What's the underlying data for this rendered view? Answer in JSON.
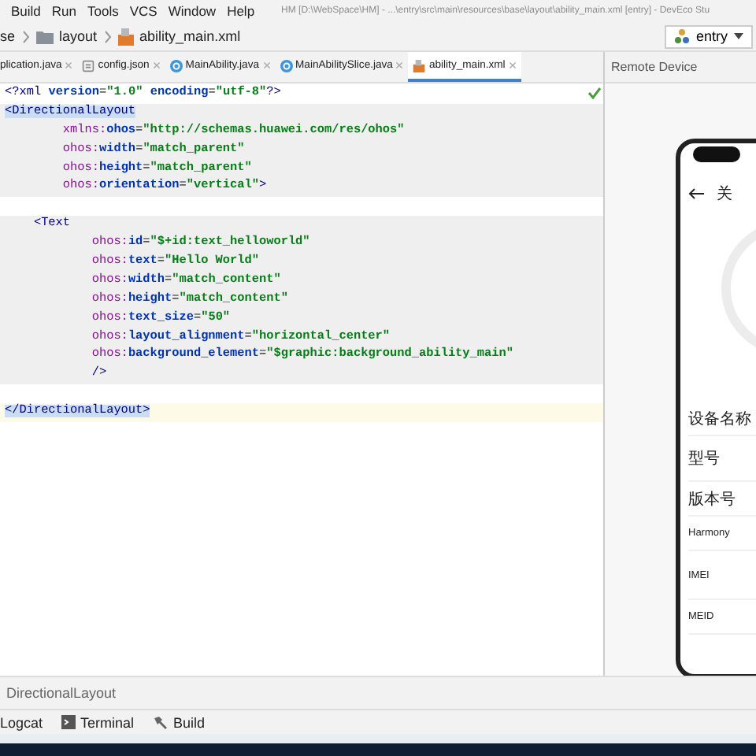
{
  "menu_bar": {
    "items": [
      "Build",
      "Run",
      "Tools",
      "VCS",
      "Window",
      "Help"
    ],
    "title": "HM [D:\\WebSpace\\HM] - ...\\entry\\src\\main\\resources\\base\\layout\\ability_main.xml [entry] - DevEco Stu"
  },
  "breadcrumb": [
    {
      "label": "se",
      "kind": "text"
    },
    {
      "label": "layout",
      "kind": "folder"
    },
    {
      "label": "ability_main.xml",
      "kind": "file"
    }
  ],
  "run_config": {
    "label": "entry"
  },
  "tabs": [
    {
      "label": "plication.java",
      "kind": "plain",
      "selected": false
    },
    {
      "label": "config.json",
      "kind": "json",
      "selected": false
    },
    {
      "label": "MainAbility.java",
      "kind": "class",
      "selected": false
    },
    {
      "label": "MainAbilitySlice.java",
      "kind": "class",
      "selected": false
    },
    {
      "label": "ability_main.xml",
      "kind": "xml",
      "selected": true
    }
  ],
  "editor": {
    "lines": [
      {
        "text": "<?xml version=\"1.0\" encoding=\"utf-8\"?>",
        "shaded": false,
        "current": false,
        "matched": false
      },
      {
        "text": "<DirectionalLayout",
        "shaded": true,
        "current": false,
        "matched": true
      },
      {
        "text": "        xmlns:ohos=\"http://schemas.huawei.com/res/ohos\"",
        "shaded": true,
        "current": false,
        "matched": false
      },
      {
        "text": "        ohos:width=\"match_parent\"",
        "shaded": true,
        "current": false,
        "matched": false
      },
      {
        "text": "        ohos:height=\"match_parent\"",
        "shaded": true,
        "current": false,
        "matched": false
      },
      {
        "text": "        ohos:orientation=\"vertical\">",
        "shaded": true,
        "current": false,
        "matched": false
      },
      {
        "shaded": false,
        "current": false,
        "matched": false
      },
      {
        "text": "    <Text",
        "shaded": true,
        "current": false,
        "matched": false
      },
      {
        "text": "            ohos:id=\"$+id:text_helloworld\"",
        "shaded": true,
        "current": false,
        "matched": false
      },
      {
        "text": "            ohos:text=\"Hello World\"",
        "shaded": true,
        "current": false,
        "matched": false
      },
      {
        "text": "            ohos:width=\"match_content\"",
        "shaded": true,
        "current": false,
        "matched": false
      },
      {
        "text": "            ohos:height=\"match_content\"",
        "shaded": true,
        "current": false,
        "matched": false
      },
      {
        "text": "            ohos:text_size=\"50\"",
        "shaded": true,
        "current": false,
        "matched": false
      },
      {
        "text": "            ohos:layout_alignment=\"horizontal_center\"",
        "shaded": true,
        "current": false,
        "matched": false
      },
      {
        "text": "            ohos:background_element=\"$graphic:background_ability_main\"",
        "shaded": true,
        "current": false,
        "matched": false
      },
      {
        "text": "            />",
        "shaded": true,
        "current": false,
        "matched": false
      },
      {
        "shaded": false,
        "current": false,
        "matched": false
      },
      {
        "text": "</DirectionalLayout>",
        "shaded": false,
        "current": true,
        "matched": true
      }
    ]
  },
  "remote_device": {
    "title": "Remote Device",
    "phone": {
      "title": "关",
      "items": [
        "设备名称",
        "型号",
        "版本号",
        "Harmony",
        "IMEI",
        "MEID"
      ]
    }
  },
  "editor_breadcrumb": "DirectionalLayout",
  "tool_tabs": [
    {
      "label": "Logcat",
      "kind": "plain"
    },
    {
      "label": "Terminal",
      "kind": "terminal"
    },
    {
      "label": "Build",
      "kind": "build"
    }
  ]
}
